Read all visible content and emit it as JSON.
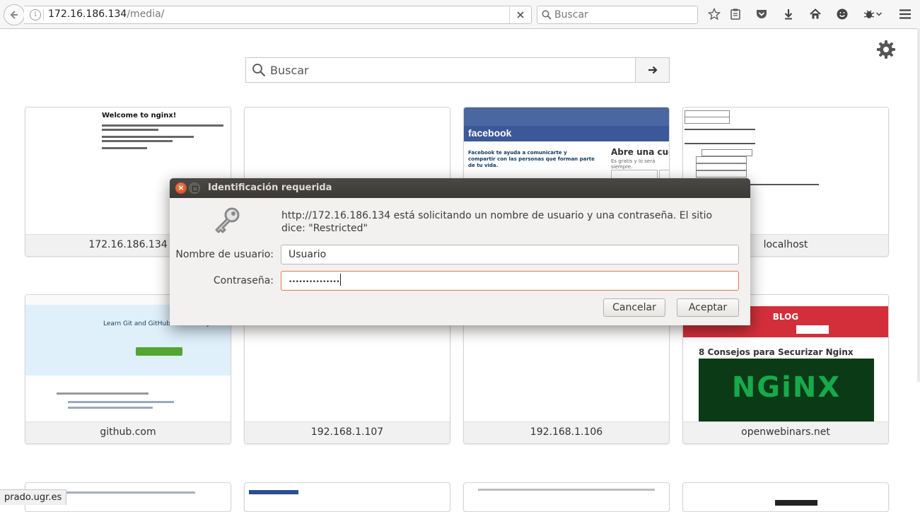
{
  "browser": {
    "url_host": "172.16.186.134",
    "url_path": "/media/",
    "search_placeholder": "Buscar"
  },
  "newtab": {
    "search_placeholder": "Buscar",
    "tiles": [
      {
        "label": "172.16.186.134",
        "thumb": "nginx"
      },
      {
        "label": "",
        "thumb": "blank"
      },
      {
        "label": "",
        "thumb": "facebook"
      },
      {
        "label": "localhost",
        "thumb": "form"
      },
      {
        "label": "github.com",
        "thumb": "github"
      },
      {
        "label": "192.168.1.107",
        "thumb": "blank"
      },
      {
        "label": "192.168.1.106",
        "thumb": "blank"
      },
      {
        "label": "openwebinars.net",
        "thumb": "blog"
      }
    ],
    "thumbs": {
      "nginx_title": "Welcome to nginx!",
      "facebook_logo": "facebook",
      "facebook_tagline": "Facebook te ayuda a comunicarte y compartir con las personas que forman parte de tu vida.",
      "facebook_signup": "Abre una cuer",
      "facebook_free": "Es gratis y lo será siempre.",
      "github_hero": "Learn Git and GitHub without any code!",
      "blog_banner": "BLOG",
      "blog_heading": "8 Consejos para Securizar Nginx",
      "blog_image_text": "NGiNX"
    }
  },
  "dialog": {
    "title": "Identificación requerida",
    "message": "http://172.16.186.134 está solicitando un nombre de usuario y una contraseña. El sitio dice: \"Restricted\"",
    "username_label": "Nombre de usuario:",
    "username_value": "Usuario",
    "password_label": "Contraseña:",
    "password_value": "•••••••••••••••",
    "cancel_label": "Cancelar",
    "accept_label": "Aceptar"
  },
  "statusbar": {
    "text": "prado.ugr.es"
  },
  "colors": {
    "dialog_titlebar": "#3c3b37",
    "focus_border": "#e37a4b",
    "facebook_blue": "#3b5998",
    "blog_red": "#d32f3a",
    "nginx_green": "#18a94a"
  }
}
